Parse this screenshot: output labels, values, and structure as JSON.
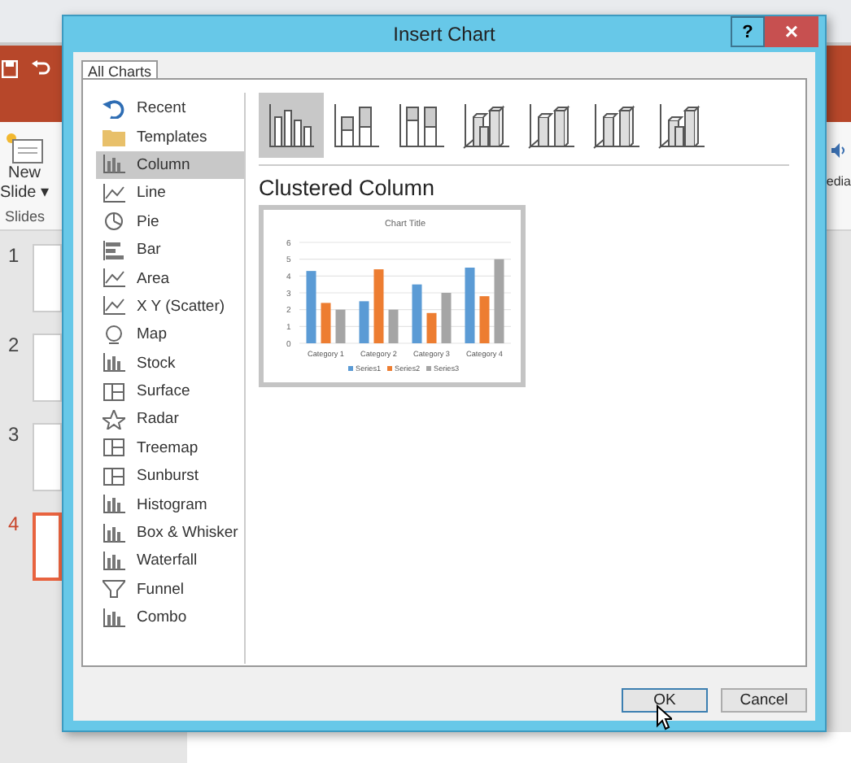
{
  "app": {
    "ribbon": {
      "new_slide": [
        "New",
        "Slide"
      ],
      "caret": "▾",
      "group_label": "Slides",
      "media_fragment": "edia"
    },
    "slides": [
      {
        "number": "1",
        "selected": false
      },
      {
        "number": "2",
        "selected": false
      },
      {
        "number": "3",
        "selected": false
      },
      {
        "number": "4",
        "selected": true
      }
    ]
  },
  "dialog": {
    "title": "Insert Chart",
    "help": "?",
    "close": "×",
    "tabs": [
      {
        "label": "All Charts",
        "selected": true
      }
    ],
    "chart_types": [
      {
        "label": "Recent",
        "kind": "recent",
        "selected": false
      },
      {
        "label": "Templates",
        "kind": "folder",
        "selected": false
      },
      {
        "label": "Column",
        "kind": "column",
        "selected": true
      },
      {
        "label": "Line",
        "kind": "line",
        "selected": false
      },
      {
        "label": "Pie",
        "kind": "pie",
        "selected": false
      },
      {
        "label": "Bar",
        "kind": "bar",
        "selected": false
      },
      {
        "label": "Area",
        "kind": "area",
        "selected": false
      },
      {
        "label": "X Y (Scatter)",
        "kind": "scatter",
        "selected": false
      },
      {
        "label": "Map",
        "kind": "globe",
        "selected": false
      },
      {
        "label": "Stock",
        "kind": "stock",
        "selected": false
      },
      {
        "label": "Surface",
        "kind": "surface",
        "selected": false
      },
      {
        "label": "Radar",
        "kind": "radar",
        "selected": false
      },
      {
        "label": "Treemap",
        "kind": "treemap",
        "selected": false
      },
      {
        "label": "Sunburst",
        "kind": "sunburst",
        "selected": false
      },
      {
        "label": "Histogram",
        "kind": "histogram",
        "selected": false
      },
      {
        "label": "Box & Whisker",
        "kind": "box",
        "selected": false
      },
      {
        "label": "Waterfall",
        "kind": "waterfall",
        "selected": false
      },
      {
        "label": "Funnel",
        "kind": "funnel",
        "selected": false
      },
      {
        "label": "Combo",
        "kind": "combo",
        "selected": false
      }
    ],
    "subtypes": [
      {
        "kind": "clustered",
        "selected": true
      },
      {
        "kind": "stacked",
        "selected": false
      },
      {
        "kind": "stacked100",
        "selected": false
      },
      {
        "kind": "clustered3d",
        "selected": false
      },
      {
        "kind": "stacked3d",
        "selected": false
      },
      {
        "kind": "stacked100_3d",
        "selected": false
      },
      {
        "kind": "column3d",
        "selected": false
      }
    ],
    "subtype_title": "Clustered Column",
    "preview": {
      "chart_data": {
        "type": "bar",
        "title": "Chart Title",
        "categories": [
          "Category 1",
          "Category 2",
          "Category 3",
          "Category 4"
        ],
        "series": [
          {
            "name": "Series1",
            "color": "#5b9bd5",
            "values": [
              4.3,
              2.5,
              3.5,
              4.5
            ]
          },
          {
            "name": "Series2",
            "color": "#ed7d31",
            "values": [
              2.4,
              4.4,
              1.8,
              2.8
            ]
          },
          {
            "name": "Series3",
            "color": "#a5a5a5",
            "values": [
              2,
              2,
              3,
              5
            ]
          }
        ],
        "ylim": [
          0,
          6
        ],
        "yticks": [
          0,
          1,
          2,
          3,
          4,
          5,
          6
        ],
        "grid": true,
        "legend": true
      }
    },
    "buttons": [
      {
        "label": "OK",
        "kind": "default"
      },
      {
        "label": "Cancel",
        "kind": "normal"
      }
    ]
  }
}
